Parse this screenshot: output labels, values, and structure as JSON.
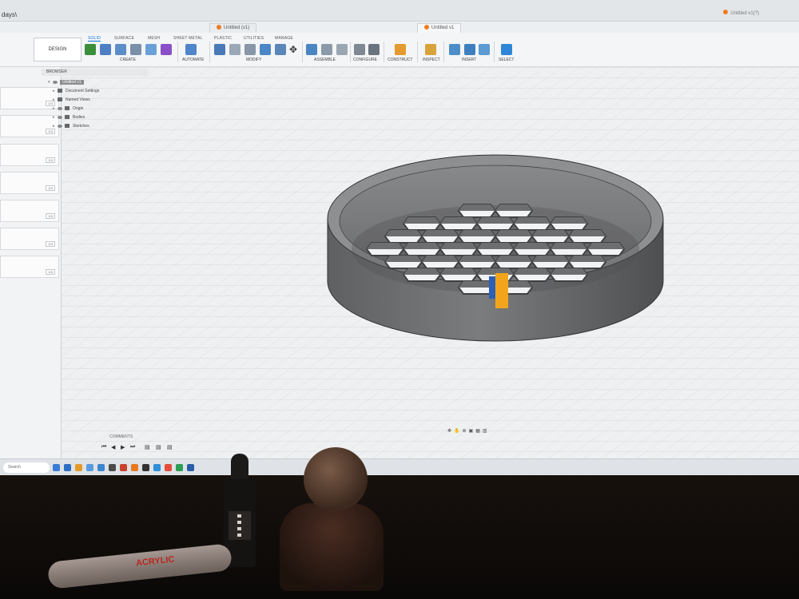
{
  "window": {
    "app_title": "days\\",
    "doc_tabs": [
      "Untitled (v1)",
      "Untitled v1"
    ],
    "user_doc": "Untitled v1(?)"
  },
  "ribbon": {
    "workspace": "DESIGN",
    "tabs": [
      "SOLID",
      "SURFACE",
      "MESH",
      "SHEET METAL",
      "PLASTIC",
      "UTILITIES",
      "MANAGE"
    ],
    "active_tab": "SOLID",
    "groups": [
      "CREATE",
      "AUTOMATE",
      "MODIFY",
      "ASSEMBLE",
      "CONFIGURE",
      "CONSTRUCT",
      "INSPECT",
      "INSERT",
      "SELECT"
    ]
  },
  "browser": {
    "header": "BROWSER",
    "root": "Untitled v1",
    "items": [
      "Document Settings",
      "Named Views",
      "Origin",
      "Bodies",
      "Sketches"
    ]
  },
  "left_panel": {
    "rows": [
      "1/4",
      "1/4",
      "1/4",
      "1/4",
      "1/4",
      "1/4",
      "1/4"
    ]
  },
  "timeline": {
    "label": "COMMENTS"
  },
  "taskbar": {
    "search": "Search"
  },
  "desk": {
    "tube_text": "ACRYLIC"
  },
  "colors": {
    "accent": "#0a74da",
    "model_gray": "#6f7173",
    "grid_bg": "#eef0f2",
    "brand_orange": "#f07c1f"
  }
}
